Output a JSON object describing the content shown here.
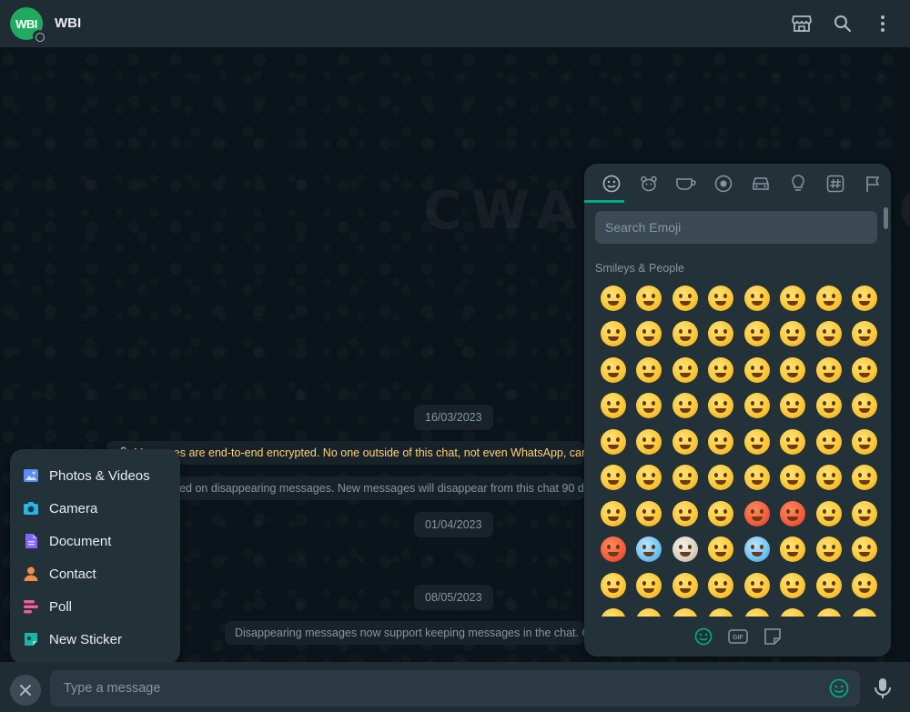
{
  "header": {
    "avatar_text": "WBI",
    "contact_name": "WBI",
    "icons": [
      "catalog-icon",
      "search-icon",
      "more-vert-icon"
    ]
  },
  "chat": {
    "watermark": "CWABETAINFO",
    "dates": [
      "16/03/2023",
      "01/04/2023",
      "08/05/2023"
    ],
    "messages": {
      "encryption": "🔒 Messages are end-to-end encrypted. No one outside of this chat, not even WhatsApp, can read or listen to them.",
      "disappearing_on": "You turned on disappearing messages. New messages will disappear from this chat 90 days after they're sent.",
      "keep": "Disappearing messages now support keeping messages in the chat. Click to learn more."
    }
  },
  "attach_menu": {
    "items": [
      {
        "label": "Photos & Videos",
        "color": "#5c8df5"
      },
      {
        "label": "Camera",
        "color": "#2cb3e6"
      },
      {
        "label": "Document",
        "color": "#7f66ff"
      },
      {
        "label": "Contact",
        "color": "#f08c4a"
      },
      {
        "label": "Poll",
        "color": "#f25c9a"
      },
      {
        "label": "New Sticker",
        "color": "#1bb5a1"
      }
    ]
  },
  "emoji_panel": {
    "tabs": [
      "smileys-icon",
      "animals-icon",
      "food-icon",
      "activity-icon",
      "travel-icon",
      "objects-icon",
      "symbols-icon",
      "flags-icon"
    ],
    "search_placeholder": "Search Emoji",
    "section_title": "Smileys & People",
    "bottom_tabs": [
      "emoji-tab-icon",
      "gif-icon",
      "sticker-icon"
    ],
    "gif_label": "GIF"
  },
  "composer": {
    "placeholder": "Type a message"
  },
  "colors": {
    "accent": "#00a884",
    "header_bg": "#202c33",
    "panel_bg": "#233138"
  }
}
